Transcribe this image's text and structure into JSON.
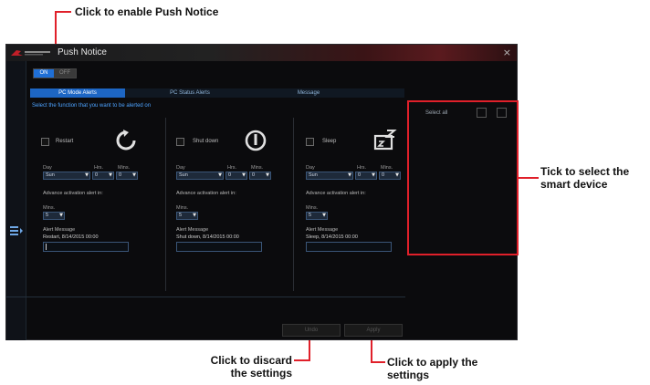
{
  "callouts": {
    "push_notice": "Click to enable Push Notice",
    "select_device_1": "Tick to select the",
    "select_device_2": "smart device",
    "discard_1": "Click to discard",
    "discard_2": "the settings",
    "apply_1": "Click to apply the",
    "apply_2": "settings"
  },
  "app": {
    "title": "Push Notice",
    "close": "×",
    "toggle": {
      "on": "ON",
      "off": "OFF",
      "state": "on"
    }
  },
  "tabs": [
    {
      "label": "PC Mode Alerts",
      "active": true
    },
    {
      "label": "PC Status Alerts",
      "active": false
    },
    {
      "label": "Message",
      "active": false
    }
  ],
  "main": {
    "instruction": "Select the function that you want to be alerted on",
    "functions": [
      {
        "label": "Restart",
        "icon": "restart-icon",
        "checked": false,
        "day_label": "Day",
        "hrs_label": "Hrs.",
        "mins_label": "Mins.",
        "day": "Sun",
        "hrs": "0",
        "mins": "0",
        "advance_label": "Advance activation alert in:",
        "adv_mins_label": "Mins.",
        "adv_mins": "5",
        "alert_label": "Alert Message",
        "alert_message": "Restart, 8/14/2015 00:00"
      },
      {
        "label": "Shut down",
        "icon": "power-icon",
        "checked": false,
        "day_label": "Day",
        "hrs_label": "Hrs.",
        "mins_label": "Mins.",
        "day": "Sun",
        "hrs": "0",
        "mins": "0",
        "advance_label": "Advance activation alert in:",
        "adv_mins_label": "Mins.",
        "adv_mins": "5",
        "alert_label": "Alert Message",
        "alert_message": "Shut down, 8/14/2015 00:00"
      },
      {
        "label": "Sleep",
        "icon": "sleep-icon",
        "checked": false,
        "day_label": "Day",
        "hrs_label": "Hrs.",
        "mins_label": "Mins.",
        "day": "Sun",
        "hrs": "0",
        "mins": "0",
        "advance_label": "Advance activation alert in:",
        "adv_mins_label": "Mins.",
        "adv_mins": "5",
        "alert_label": "Alert Message",
        "alert_message": "Sleep, 8/14/2015 00:00"
      }
    ]
  },
  "buttons": {
    "discard": "Undo",
    "apply": "Apply"
  },
  "device_panel": {
    "select_all": "Select all"
  },
  "colors": {
    "accent": "#1d66c4",
    "highlight": "#e0202a",
    "background": "#0b0b0d"
  }
}
